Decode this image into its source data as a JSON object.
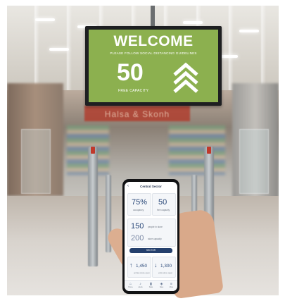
{
  "monitor": {
    "welcome": "WELCOME",
    "guideline": "PLEASE FOLLOW SOCIAL DISTANCING GUIDELINES",
    "free_count": "50",
    "free_label": "FREE CAPACITY",
    "icon": "chevron-up-triple-icon",
    "background_color": "#8cb04f"
  },
  "store_sign": "Halsa & Skonh",
  "app": {
    "title": "Central Sector",
    "back_icon": "back-arrow-icon",
    "occupancy_value": "75%",
    "occupancy_label": "occupancy",
    "free_value": "50",
    "free_label": "free capacity",
    "people_value": "150",
    "people_label": "people in store",
    "total_value": "200",
    "total_label": "store capacity",
    "button_label": "SECTOR",
    "in_value": "1,450",
    "in_label": "entries since open",
    "out_value": "1,300",
    "out_label": "exits since open",
    "tabs": [
      {
        "label": "Home",
        "icon": "home-icon"
      },
      {
        "label": "Alerts",
        "icon": "bell-icon"
      },
      {
        "label": "Stats",
        "icon": "chart-icon"
      },
      {
        "label": "Sites",
        "icon": "map-icon"
      },
      {
        "label": "More",
        "icon": "menu-icon"
      }
    ],
    "accent_color": "#25406d"
  }
}
